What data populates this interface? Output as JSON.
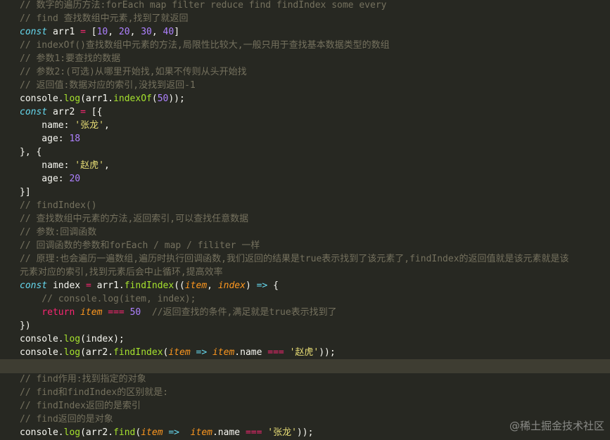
{
  "editor": {
    "lines": [
      [
        [
          "c",
          "// 数字的遍历方法:forEach map filter reduce find findIndex some every"
        ]
      ],
      [
        [
          "c",
          "// find 查找数组中元素,找到了就返回"
        ]
      ],
      [
        [
          "k",
          "const"
        ],
        [
          "pl",
          " arr1 "
        ],
        [
          "op",
          "="
        ],
        [
          "pl",
          " ["
        ],
        [
          "n",
          "10"
        ],
        [
          "pl",
          ", "
        ],
        [
          "n",
          "20"
        ],
        [
          "pl",
          ", "
        ],
        [
          "n",
          "30"
        ],
        [
          "pl",
          ", "
        ],
        [
          "n",
          "40"
        ],
        [
          "pl",
          "]"
        ]
      ],
      [
        [
          "c",
          "// indexOf()查找数组中元素的方法,局限性比较大,一般只用于查找基本数据类型的数组"
        ]
      ],
      [
        [
          "c",
          "// 参数1:要查找的数据"
        ]
      ],
      [
        [
          "c",
          "// 参数2:(可选)从哪里开始找,如果不传则从头开始找"
        ]
      ],
      [
        [
          "c",
          "// 返回值:数据对应的索引,没找到返回-1"
        ]
      ],
      [
        [
          "pl",
          "console."
        ],
        [
          "f",
          "log"
        ],
        [
          "pl",
          "(arr1."
        ],
        [
          "f",
          "indexOf"
        ],
        [
          "pl",
          "("
        ],
        [
          "n",
          "50"
        ],
        [
          "pl",
          "));"
        ]
      ],
      [
        [
          "k",
          "const"
        ],
        [
          "pl",
          " arr2 "
        ],
        [
          "op",
          "="
        ],
        [
          "pl",
          " [{"
        ]
      ],
      [
        [
          "pl",
          "    name: "
        ],
        [
          "s",
          "'张龙'"
        ],
        [
          "pl",
          ","
        ]
      ],
      [
        [
          "pl",
          "    age: "
        ],
        [
          "n",
          "18"
        ]
      ],
      [
        [
          "pl",
          "}, {"
        ]
      ],
      [
        [
          "pl",
          "    name: "
        ],
        [
          "s",
          "'赵虎'"
        ],
        [
          "pl",
          ","
        ]
      ],
      [
        [
          "pl",
          "    age: "
        ],
        [
          "n",
          "20"
        ]
      ],
      [
        [
          "pl",
          "}]"
        ]
      ],
      [
        [
          "c",
          "// findIndex()"
        ]
      ],
      [
        [
          "c",
          "// 查找数组中元素的方法,返回索引,可以查找任意数据"
        ]
      ],
      [
        [
          "c",
          "// 参数:回调函数"
        ]
      ],
      [
        [
          "c",
          "// 回调函数的参数和forEach / map / filiter 一样"
        ]
      ],
      [
        [
          "c",
          "// 原理:也会遍历一遍数组,遍历时执行回调函数,我们返回的结果是true表示找到了该元素了,findIndex的返回值就是该元素就是该"
        ]
      ],
      [
        [
          "c",
          "元素对应的索引,找到元素后会中止循环,提高效率"
        ]
      ],
      [
        [
          "k",
          "const"
        ],
        [
          "pl",
          " index "
        ],
        [
          "op",
          "="
        ],
        [
          "pl",
          " arr1."
        ],
        [
          "f",
          "findIndex"
        ],
        [
          "pl",
          "(("
        ],
        [
          "p",
          "item"
        ],
        [
          "pl",
          ", "
        ],
        [
          "p",
          "index"
        ],
        [
          "pl",
          ") "
        ],
        [
          "k",
          "=>"
        ],
        [
          "pl",
          " {"
        ]
      ],
      [
        [
          "c",
          "    // console.log(item, index);"
        ]
      ],
      [
        [
          "rk",
          "    return"
        ],
        [
          "pl",
          " "
        ],
        [
          "p",
          "item"
        ],
        [
          "pl",
          " "
        ],
        [
          "op",
          "==="
        ],
        [
          "pl",
          " "
        ],
        [
          "n",
          "50"
        ],
        [
          "pl",
          "  "
        ],
        [
          "c",
          "//返回查找的条件,满足就是true表示找到了"
        ]
      ],
      [
        [
          "pl",
          "})"
        ]
      ],
      [
        [
          "pl",
          "console."
        ],
        [
          "f",
          "log"
        ],
        [
          "pl",
          "(index);"
        ]
      ],
      [
        [
          "pl",
          "console."
        ],
        [
          "f",
          "log"
        ],
        [
          "pl",
          "(arr2."
        ],
        [
          "f",
          "findIndex"
        ],
        [
          "pl",
          "("
        ],
        [
          "p",
          "item"
        ],
        [
          "pl",
          " "
        ],
        [
          "k",
          "=>"
        ],
        [
          "pl",
          " "
        ],
        [
          "p",
          "item"
        ],
        [
          "pl",
          ".name "
        ],
        [
          "op",
          "==="
        ],
        [
          "pl",
          " "
        ],
        [
          "s",
          "'赵虎'"
        ],
        [
          "pl",
          "));"
        ]
      ],
      [],
      [
        [
          "c",
          "// find作用:找到指定的对象"
        ]
      ],
      [
        [
          "c",
          "// find和findIndex的区别就是:"
        ]
      ],
      [
        [
          "c",
          "// findIndex返回的是索引"
        ]
      ],
      [
        [
          "c",
          "// find返回的是对象"
        ]
      ],
      [
        [
          "pl",
          "console."
        ],
        [
          "f",
          "log"
        ],
        [
          "pl",
          "(arr2."
        ],
        [
          "f",
          "find"
        ],
        [
          "pl",
          "("
        ],
        [
          "p",
          "item"
        ],
        [
          "pl",
          " "
        ],
        [
          "k",
          "=>"
        ],
        [
          "pl",
          "  "
        ],
        [
          "p",
          "item"
        ],
        [
          "pl",
          ".name "
        ],
        [
          "op",
          "==="
        ],
        [
          "pl",
          " "
        ],
        [
          "s",
          "'张龙'"
        ],
        [
          "pl",
          "));"
        ]
      ]
    ],
    "highlighted_line": 27
  },
  "watermark": "@稀土掘金技术社区"
}
